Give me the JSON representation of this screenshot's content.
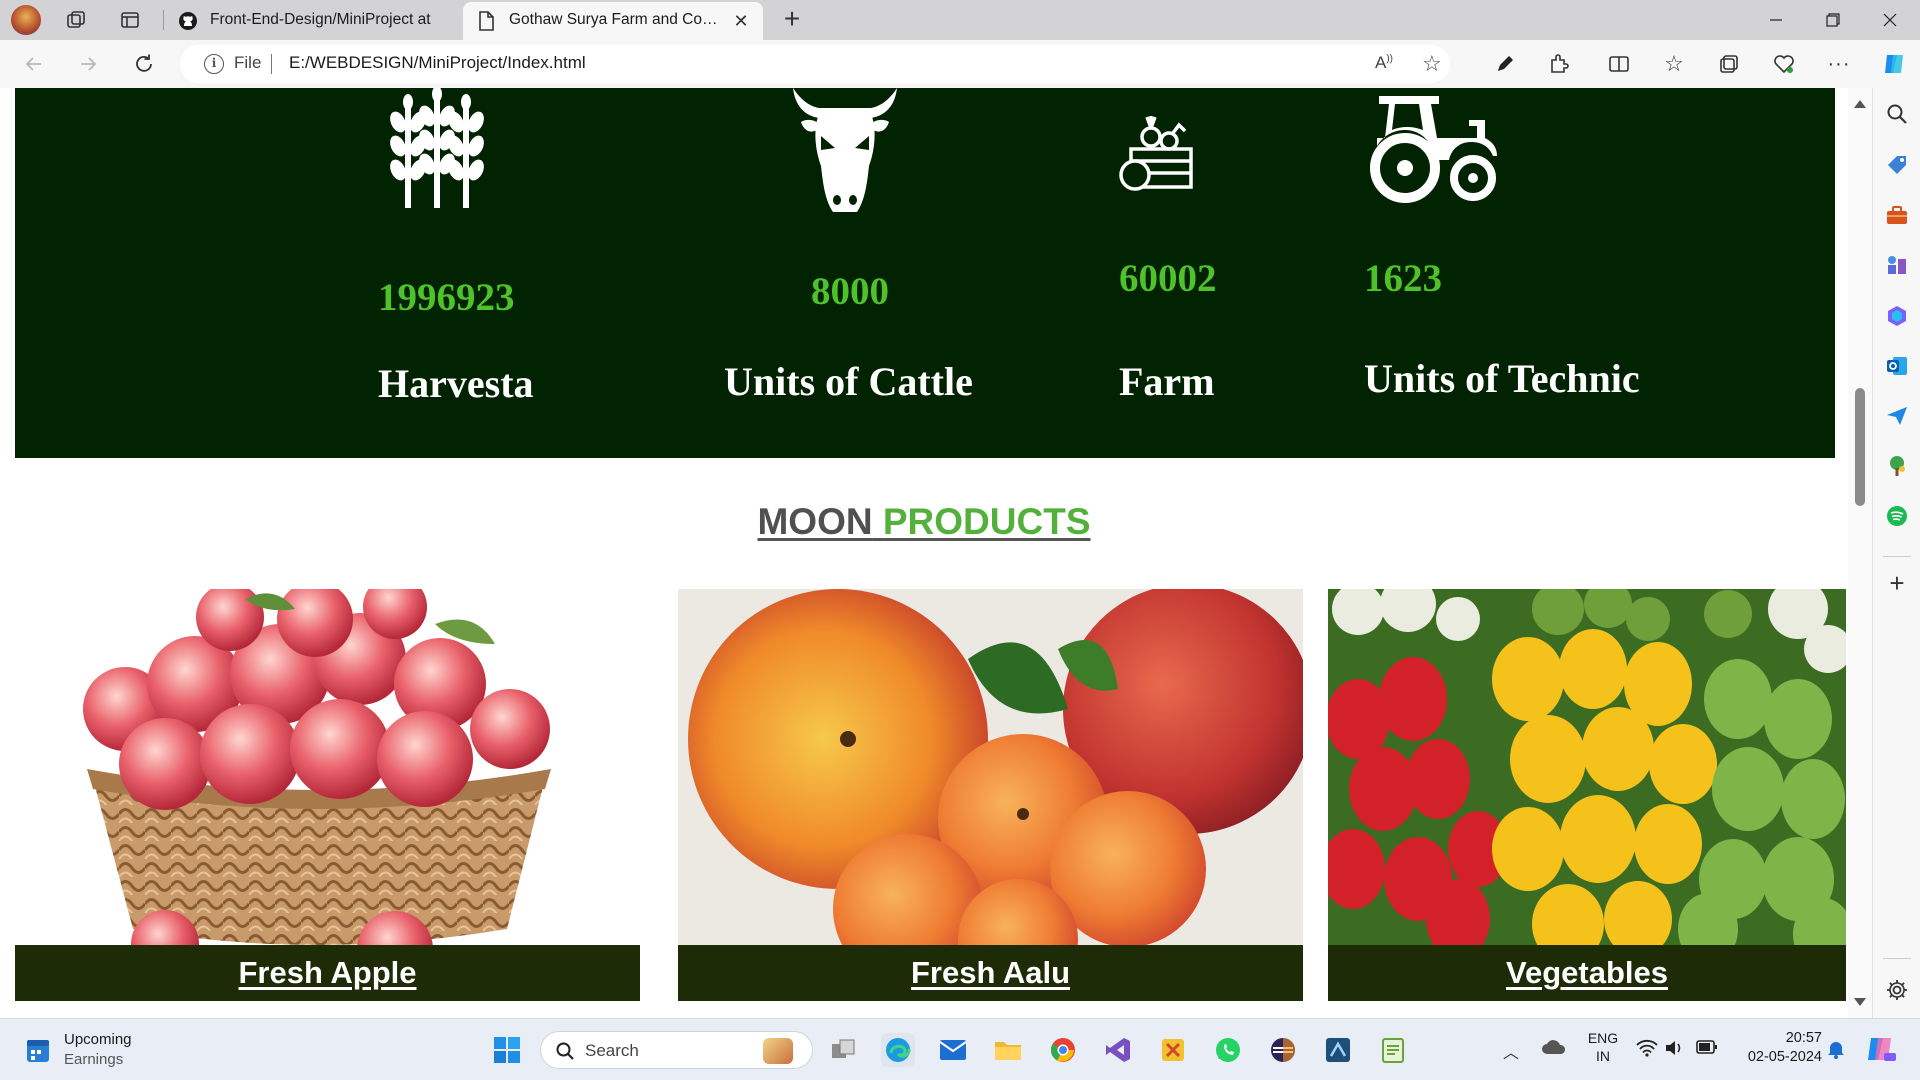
{
  "browser": {
    "tabs": [
      {
        "title": "Front-End-Design/MiniProject at",
        "icon": "github-icon",
        "active": false
      },
      {
        "title": "Gothaw Surya Farm and Compan",
        "icon": "page-icon",
        "active": true
      }
    ],
    "address": {
      "scheme_label": "File",
      "url": "E:/WEBDESIGN/MiniProject/Index.html"
    }
  },
  "stats": [
    {
      "value": "1996923",
      "label": "Harvesta",
      "icon": "wheat-icon"
    },
    {
      "value": "8000",
      "label": "Units of Cattle",
      "icon": "cow-icon"
    },
    {
      "value": "60002",
      "label": "Farm",
      "icon": "crate-icon"
    },
    {
      "value": "1623",
      "label": "Units of Technic",
      "icon": "tractor-icon"
    }
  ],
  "products_section": {
    "title_part1": "MOON",
    "title_part2": "PRODUCTS",
    "items": [
      {
        "caption": "Fresh Apple",
        "image": "apple-basket-image"
      },
      {
        "caption": "Fresh Aalu",
        "image": "peaches-image"
      },
      {
        "caption": "Vegetables",
        "image": "bell-peppers-image"
      }
    ]
  },
  "taskbar": {
    "widget_title": "Upcoming",
    "widget_subtitle": "Earnings",
    "search_placeholder": "Search",
    "lang_line1": "ENG",
    "lang_line2": "IN",
    "time": "20:57",
    "date": "02-05-2024"
  },
  "colors": {
    "stats_bg": "#022301",
    "stat_number": "#4fc12a",
    "heading_grey": "#505050",
    "heading_green": "#53b13b",
    "caption_bg": "#1d2b07"
  }
}
